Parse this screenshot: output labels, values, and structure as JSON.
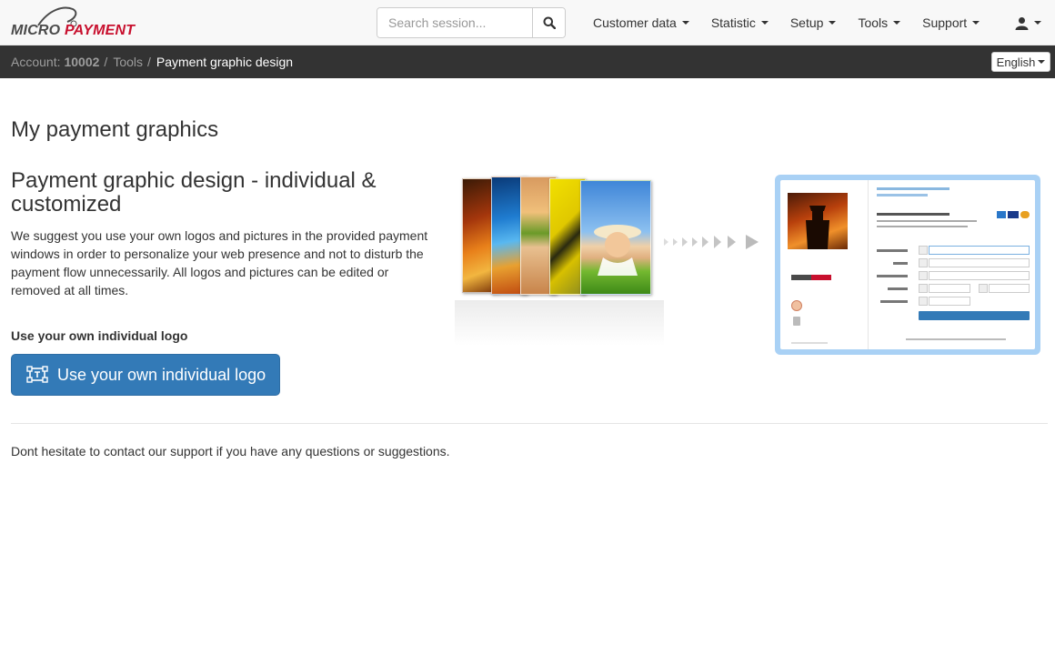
{
  "brand": {
    "logo_left": "MICRO",
    "logo_right": "PAYMENT",
    "accent_color": "#c8102e"
  },
  "search": {
    "placeholder": "Search session...",
    "button_icon": "search-icon"
  },
  "nav": {
    "items": [
      {
        "label": "Customer data"
      },
      {
        "label": "Statistic"
      },
      {
        "label": "Setup"
      },
      {
        "label": "Tools"
      },
      {
        "label": "Support"
      }
    ],
    "user_icon": "user-icon"
  },
  "breadcrumb": {
    "account_label": "Account:",
    "account_number": "10002",
    "tools": "Tools",
    "current": "Payment graphic design"
  },
  "language": {
    "selected": "English"
  },
  "main": {
    "page_title": "My payment graphics",
    "section_title": "Payment graphic design - individual & customized",
    "intro": "We suggest you use your own logos and pictures in the provided payment windows in order to personalize your web presence and not to disturb the payment flow unnecessarily. All logos and pictures can be edited or removed at all times.",
    "logo_section_label": "Use your own individual logo",
    "logo_button_label": "Use your own individual logo",
    "logo_button_icon": "image-edit-icon",
    "support_text": "Dont hesitate to contact our support if you have any questions or suggestions."
  },
  "colors": {
    "primary": "#337ab7",
    "navbar_bg": "#f8f8f8",
    "crumb_bg": "#333333"
  }
}
